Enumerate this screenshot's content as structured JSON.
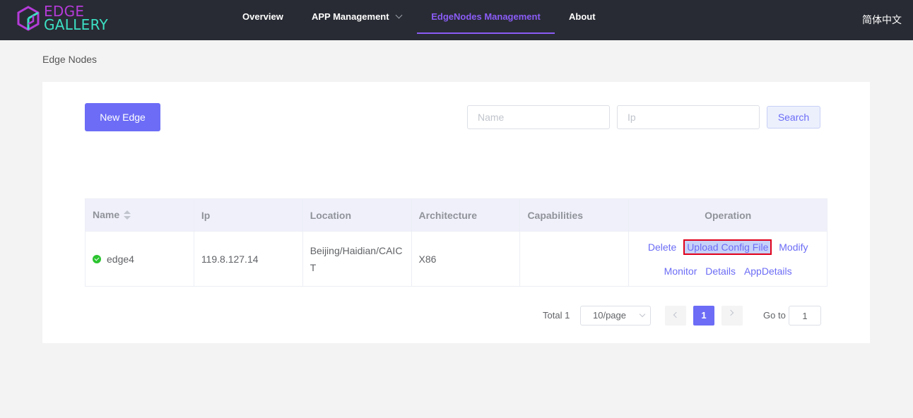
{
  "header": {
    "logo_line1": "EDGE",
    "logo_line2": "GALLERY",
    "nav": [
      {
        "label": "Overview"
      },
      {
        "label": "APP Management"
      },
      {
        "label": "EdgeNodes Management"
      },
      {
        "label": "About"
      }
    ],
    "active_nav": "EdgeNodes Management",
    "language": "简体中文",
    "colors": {
      "bg": "#282b33",
      "active": "#8a5cf6",
      "logo_edge": "#b43bd8",
      "logo_gallery": "#3ce0c4"
    }
  },
  "breadcrumb": "Edge Nodes",
  "toolbar": {
    "new_edge_label": "New Edge",
    "name_placeholder": "Name",
    "ip_placeholder": "Ip",
    "search_label": "Search"
  },
  "table": {
    "columns": [
      "Name",
      "Ip",
      "Location",
      "Architecture",
      "Capabilities",
      "Operation"
    ],
    "rows": [
      {
        "status": "online",
        "name": "edge4",
        "ip": "119.8.127.14",
        "location": "Beijing/Haidian/CAICT",
        "architecture": "X86",
        "capabilities": "",
        "operations_row1": [
          "Delete",
          "Upload Config File",
          "Modify"
        ],
        "operations_row2": [
          "Monitor",
          "Details",
          "AppDetails"
        ]
      }
    ]
  },
  "pagination": {
    "total_label": "Total 1",
    "page_size": "10/page",
    "current_page": "1",
    "goto_label": "Go to",
    "goto_value": "1"
  },
  "accent_color": "#6c6cf6",
  "highlight": {
    "target": "Upload Config File",
    "border_color": "#e0001b"
  }
}
